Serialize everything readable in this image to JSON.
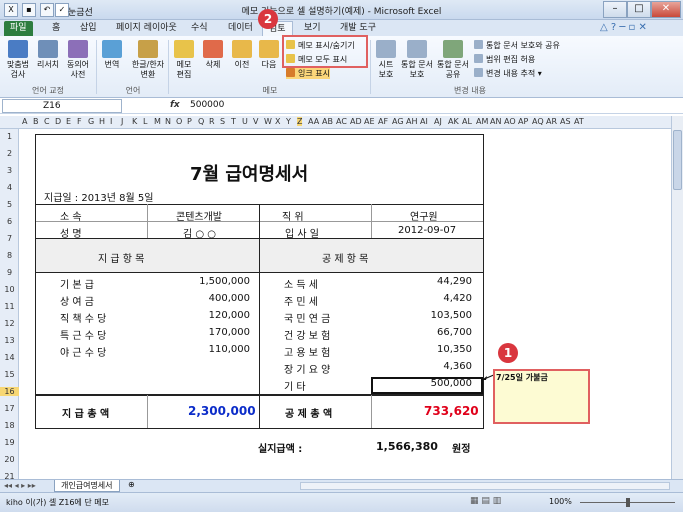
{
  "window": {
    "title": "메모 기능으로 셀 설명하기(예제) - Microsoft Excel",
    "quick_access_label": "눈금선"
  },
  "tabs": [
    "파일",
    "홈",
    "삽입",
    "페이지 레이아웃",
    "수식",
    "데이터",
    "검토",
    "보기",
    "개발 도구"
  ],
  "ribbon": {
    "buttons": {
      "spell": "맞춤법\n검사",
      "research": "리서치",
      "thesaurus": "동의어\n사전",
      "translate": "번역",
      "hanja": "한글/한자\n변환",
      "memo_edit": "메모\n편집",
      "delete": "삭제",
      "prev": "이전",
      "next": "다음",
      "protect_sheet": "시트\n보호",
      "protect_workbook": "통합 문서\n보호",
      "share_workbook": "통합 문서\n공유"
    },
    "memo_small": [
      "메모 표시/숨기기",
      "메모 모두 표시",
      "잉크 표시"
    ],
    "change_small": [
      "통합 문서 보호와 공유",
      "범위 편집 허용",
      "변경 내용 추적 ▾"
    ],
    "groups": [
      "언어 교정",
      "언어",
      "메모",
      "변경 내용"
    ]
  },
  "formula_bar": {
    "name_box": "Z16",
    "fx": "fx",
    "value": "500000"
  },
  "columns": [
    "A",
    "B",
    "C",
    "D",
    "E",
    "F",
    "G",
    "H",
    "I",
    "J",
    "K",
    "L",
    "M",
    "N",
    "O",
    "P",
    "Q",
    "R",
    "S",
    "T",
    "U",
    "V",
    "W",
    "X",
    "Y",
    "Z",
    "AA",
    "AB",
    "AC",
    "AD",
    "AE",
    "AF",
    "AG",
    "AH",
    "AI",
    "AJ",
    "AK",
    "AL",
    "AM",
    "AN",
    "AO",
    "AP",
    "AQ",
    "AR",
    "AS",
    "AT"
  ],
  "rows": [
    "1",
    "2",
    "3",
    "4",
    "5",
    "6",
    "7",
    "8",
    "9",
    "10",
    "11",
    "12",
    "13",
    "14",
    "15",
    "16",
    "17",
    "18",
    "19",
    "20",
    "21"
  ],
  "sheet": {
    "title": "7월  급여명세서",
    "pay_date": "지급일 :   2013년 8월 5일",
    "dept_label": "소          속",
    "dept_value": "콘텐츠개발",
    "position_label": "직          위",
    "position_value": "연구원",
    "name_label": "성          명",
    "name_value": "김 ○ ○",
    "join_label": "입   사   일",
    "join_value": "2012-09-07",
    "pay_header": "지     급     항     목",
    "deduct_header": "공     제     항     목",
    "pay_items": [
      {
        "label": "기   본   급",
        "value": "1,500,000"
      },
      {
        "label": "상   여   금",
        "value": "400,000"
      },
      {
        "label": "직 책 수 당",
        "value": "120,000"
      },
      {
        "label": "특 근 수 당",
        "value": "170,000"
      },
      {
        "label": "야 근 수 당",
        "value": "110,000"
      }
    ],
    "deduct_items": [
      {
        "label": "소   득   세",
        "value": "44,290"
      },
      {
        "label": "주   민   세",
        "value": "4,420"
      },
      {
        "label": "국 민 연 금",
        "value": "103,500"
      },
      {
        "label": "건 강 보 험",
        "value": "66,700"
      },
      {
        "label": "고 용 보 험",
        "value": "10,350"
      },
      {
        "label": "장 기 요 양",
        "value": "4,360"
      },
      {
        "label": "기          타",
        "value": "500,000"
      }
    ],
    "pay_total_label": "지 급 총 액",
    "pay_total_value": "2,300,000",
    "deduct_total_label": "공 제 총 액",
    "deduct_total_value": "733,620",
    "net_label": "실지급액    :",
    "net_value": "1,566,380",
    "net_unit": "원정"
  },
  "memo": {
    "text": "7/25일 가불금"
  },
  "badges": [
    "1",
    "2"
  ],
  "sheet_tab": "개인급여명세서",
  "status": {
    "text": "kiho 이(가) 셀 Z16에 단 메모",
    "zoom": "100%"
  },
  "colors": {
    "accent": "#d9363e",
    "file_tab": "#2d7d3f",
    "blue_total": "#0b2cc9",
    "red_total": "#e0001a",
    "memo_fill": "#fdfbd3"
  }
}
